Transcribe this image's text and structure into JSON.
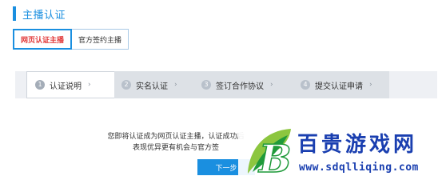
{
  "section": {
    "title": "主播认证"
  },
  "tabs": [
    {
      "label": "网页认证主播",
      "active": true
    },
    {
      "label": "官方签约主播",
      "active": false
    }
  ],
  "steps": [
    {
      "num": "1",
      "label": "认证说明",
      "arrow": "›",
      "active": true
    },
    {
      "num": "2",
      "label": "实名认证",
      "arrow": "›",
      "active": false
    },
    {
      "num": "3",
      "label": "签订合作协议",
      "arrow": "›",
      "active": false
    },
    {
      "num": "4",
      "label": "提交认证申请",
      "arrow": "›",
      "active": false
    }
  ],
  "desc": {
    "line1": "您即将认证成为网页认证主播，认证成功后",
    "line2": "表现优异更有机会与官方签"
  },
  "next_button": {
    "label": "下一步"
  },
  "watermark": {
    "logo_letter": "B",
    "title": "百贵游戏网",
    "url": "www.sdqlliqing.com"
  },
  "colors": {
    "accent": "#1a8fe0",
    "active_tab_text": "#e23a3a",
    "watermark": "#1a3fb0"
  }
}
